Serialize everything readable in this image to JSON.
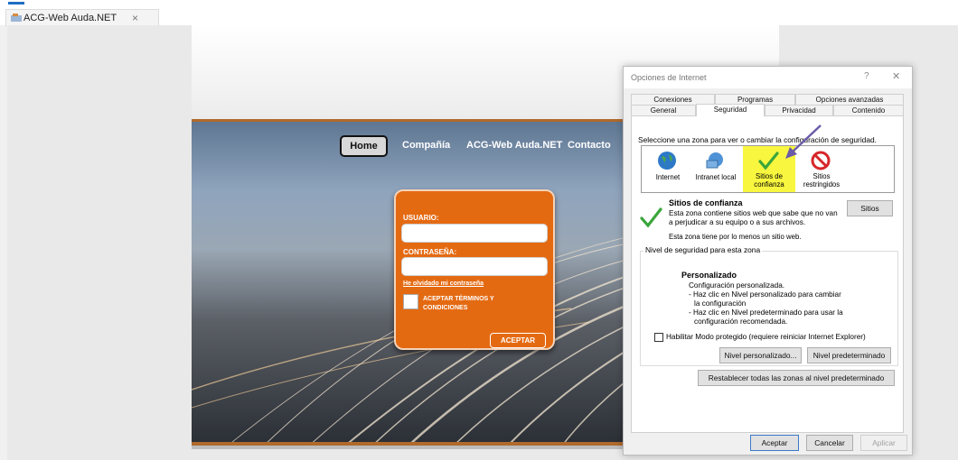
{
  "browser": {
    "tab_title": "ACG-Web Auda.NET",
    "tab_close": "×"
  },
  "site": {
    "nav": [
      "Home",
      "Compañía",
      "ACG-Web Auda.NET",
      "Contacto"
    ],
    "login": {
      "user_label": "USUARIO:",
      "password_label": "CONTRASEÑA:",
      "forgot_link": "He olvidado mi contraseña",
      "terms_label": "ACEPTAR TÉRMINOS Y CONDICIONES",
      "accept_button": "ACEPTAR"
    },
    "accent_color": "#e46a12"
  },
  "dialog": {
    "title": "Opciones de Internet",
    "help": "?",
    "close": "✕",
    "tabs_row1": [
      "Conexiones",
      "Programas",
      "Opciones avanzadas"
    ],
    "tabs_row2": [
      "General",
      "Seguridad",
      "Privacidad",
      "Contenido"
    ],
    "active_tab": "Seguridad",
    "zone_prompt": "Seleccione una zona para ver o cambiar la configuración de seguridad.",
    "zones": [
      {
        "label": "Internet",
        "icon": "globe-icon"
      },
      {
        "label": "Intranet local",
        "icon": "intranet-icon"
      },
      {
        "label": "Sitios de confianza",
        "icon": "checkmark-icon",
        "selected": true
      },
      {
        "label": "Sitios restringidos",
        "icon": "no-entry-icon"
      }
    ],
    "zone_title": "Sitios de confianza",
    "zone_desc": "Esta zona contiene sitios web que sabe que no van a perjudicar a su equipo o a sus archivos.",
    "zone_note": "Esta zona tiene por lo menos un sitio web.",
    "sites_button": "Sitios",
    "security_level_label": "Nivel de seguridad para esta zona",
    "level_title": "Personalizado",
    "level_lines": [
      "Configuración personalizada.",
      "- Haz clic en Nivel personalizado para cambiar",
      "la configuración",
      "- Haz clic en Nivel predeterminado para usar la",
      "configuración recomendada."
    ],
    "protected_mode": "Habilitar Modo protegido (requiere reiniciar Internet Explorer)",
    "custom_level_button": "Nivel personalizado...",
    "default_level_button": "Nivel predeterminado",
    "reset_all_button": "Restablecer todas las zonas al nivel predeterminado",
    "ok_button": "Aceptar",
    "cancel_button": "Cancelar",
    "apply_button": "Aplicar"
  }
}
